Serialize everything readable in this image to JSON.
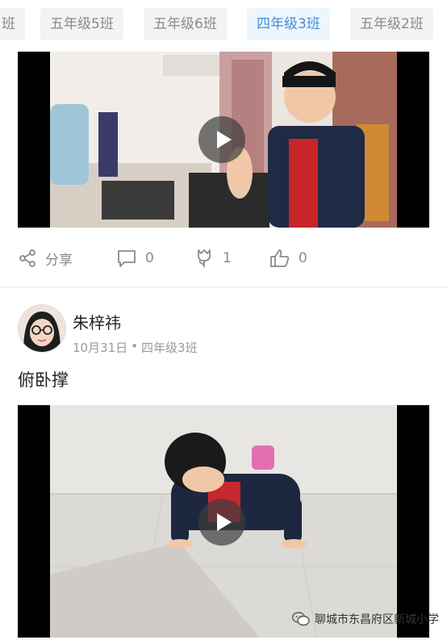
{
  "tabs": [
    {
      "label": "班",
      "active": false
    },
    {
      "label": "五年级5班",
      "active": false
    },
    {
      "label": "五年级6班",
      "active": false
    },
    {
      "label": "四年级3班",
      "active": true
    },
    {
      "label": "五年级2班",
      "active": false
    }
  ],
  "post1": {
    "actions": {
      "share_label": "分享",
      "comment_count": "0",
      "flower_count": "1",
      "like_count": "0"
    }
  },
  "post2": {
    "author": "朱梓祎",
    "date": "10月31日",
    "separator": "•",
    "class_name": "四年级3班",
    "text": "俯卧撑"
  },
  "watermark": "聊城市东昌府区新城小学",
  "icons": {
    "share": "share-icon",
    "comment": "comment-icon",
    "flower": "flower-icon",
    "like": "thumbs-up-icon",
    "play": "play-icon",
    "wechat": "wechat-icon"
  },
  "colors": {
    "active_tab_text": "#3f8fd8",
    "active_tab_bg": "#eef6fd",
    "inactive_tab_text": "#8a8a8a",
    "inactive_tab_bg": "#f3f3f3",
    "icon_gray": "#8a8a8a"
  }
}
